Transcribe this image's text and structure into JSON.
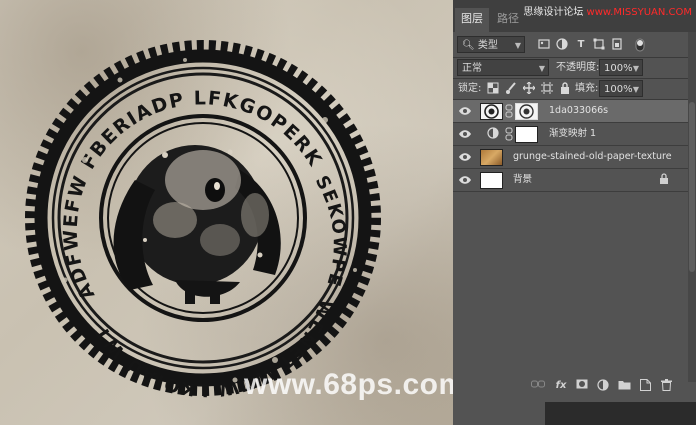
{
  "canvas": {
    "stamp_top_text": "ADFWEFW FBERIADP LFKGOPERKGP",
    "stamp_right_text": "SEKOWPET",
    "stamp_bottom_text": "WENET WTW LKOIAU WT",
    "watermark": "www.68ps.com"
  },
  "panel": {
    "tabs": [
      {
        "label": "图层",
        "active": true
      },
      {
        "label": "路径",
        "active": false
      }
    ],
    "brand_cn": "思缘设计论坛",
    "brand_url": "www.MISSYUAN.COM",
    "filter": {
      "label": "类型",
      "icon": "search-icon"
    },
    "blend_mode": "正常",
    "opacity_label": "不透明度:",
    "opacity_value": "100%",
    "lock_label": "锁定:",
    "fill_label": "填充:",
    "fill_value": "100%",
    "layers": [
      {
        "name": "1da033066s",
        "selected": true,
        "type": "image-with-mask"
      },
      {
        "name": "渐变映射 1",
        "selected": false,
        "type": "adjustment"
      },
      {
        "name": "grunge-stained-old-paper-texture",
        "selected": false,
        "type": "texture"
      },
      {
        "name": "背景",
        "selected": false,
        "type": "background",
        "locked": true
      }
    ]
  },
  "colors": {
    "panel_bg": "#535353",
    "tab_bar": "#3f3f3f",
    "selected_layer": "#6a6a6a",
    "brand_red": "#ff2a2a"
  }
}
